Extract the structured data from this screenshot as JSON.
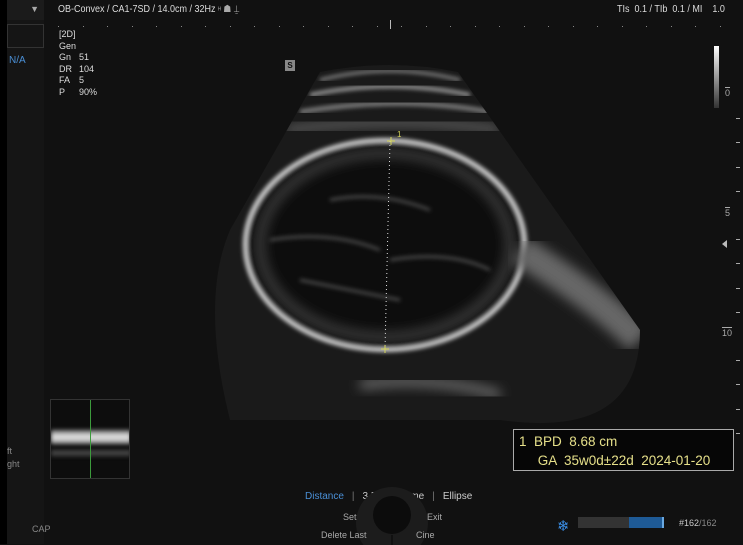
{
  "left_panel": {
    "dropdown_icon": "chevron-down-icon",
    "preset_value": "N/A",
    "label_left": "ft",
    "label_right": "ght",
    "cap_label": "CAP"
  },
  "header": {
    "probe_info": "OB-Convex / CA1-7SD / 14.0cm / 32Hz",
    "icons": [
      "har-icon",
      "biopsy-icon",
      "focus-icon"
    ],
    "indices": "TIs  0.1 / TIb  0.1 / MI    1.0"
  },
  "params": {
    "mode": "[2D]",
    "preset": "Gen",
    "rows": [
      {
        "k": "Gn",
        "v": "51"
      },
      {
        "k": "DR",
        "v": "104"
      },
      {
        "k": "FA",
        "v": "5"
      },
      {
        "k": "P",
        "v": "90%"
      }
    ]
  },
  "s_badge": "S",
  "depth_scale": {
    "labels": [
      "0",
      "5",
      "10"
    ]
  },
  "caliper": {
    "label": "1"
  },
  "result": {
    "line1": "1  BPD  8.68 cm",
    "line2": "     GA  35w0d±22d  2024-01-20"
  },
  "tools": {
    "items": [
      "Distance",
      "3 Dist Volume",
      "Ellipse"
    ],
    "active": "Distance",
    "active_color": "#4a8fd6"
  },
  "dial": {
    "set": "Set",
    "exit": "Exit",
    "delete_last": "Delete Last",
    "cine": "Cine"
  },
  "cine": {
    "frame": "#162",
    "total": "/162",
    "progress": 1.0,
    "freeze_icon": "snowflake-icon"
  }
}
